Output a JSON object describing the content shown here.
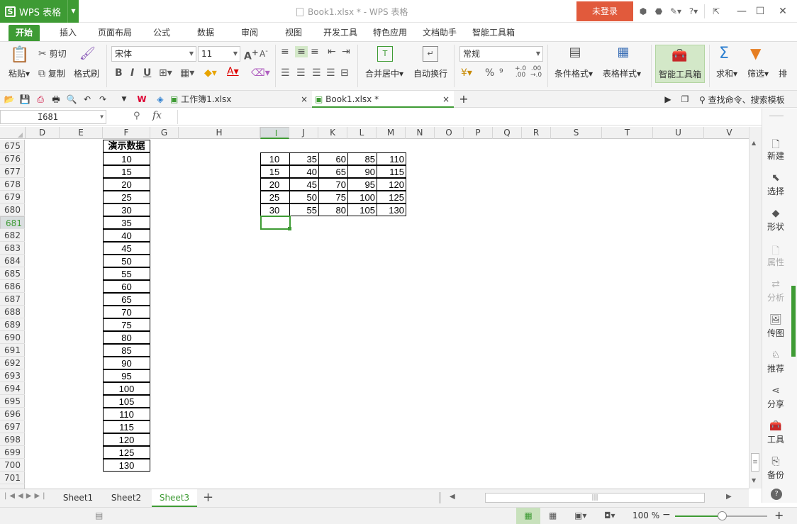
{
  "app": {
    "name": "WPS 表格",
    "window_title": "Book1.xlsx * - WPS 表格",
    "login": "未登录",
    "help": "?"
  },
  "menu": [
    "开始",
    "插入",
    "页面布局",
    "公式",
    "数据",
    "审阅",
    "视图",
    "开发工具",
    "特色应用",
    "文档助手",
    "智能工具箱"
  ],
  "ribbon": {
    "paste": "粘贴",
    "cut": "剪切",
    "copy": "复制",
    "format_painter": "格式刷",
    "font_name": "宋体",
    "font_size": "11",
    "bold": "B",
    "italic": "I",
    "underline": "U",
    "merge_center": "合并居中",
    "wrap_text": "自动换行",
    "number_format": "常规",
    "percent": "%",
    "thousands": "⁹",
    "dec_inc": "+.0\n.00",
    "dec_dec": ".00\n→.0",
    "cond_format": "条件格式",
    "table_style": "表格样式",
    "smart_toolbox": "智能工具箱",
    "sum": "求和",
    "filter": "筛选",
    "sort_partial": "排"
  },
  "doc_tabs": [
    {
      "label": "工作簿1.xlsx",
      "active": false
    },
    {
      "label": "Book1.xlsx *",
      "active": true
    }
  ],
  "search_placeholder": "查找命令、搜索模板",
  "formula_bar": {
    "name_box": "I681",
    "fx": "fx",
    "content": ""
  },
  "columns": [
    "D",
    "E",
    "F",
    "G",
    "H",
    "I",
    "J",
    "K",
    "L",
    "M",
    "N",
    "O",
    "P",
    "Q",
    "R",
    "S",
    "T",
    "U",
    "V"
  ],
  "rows": [
    "675",
    "676",
    "677",
    "678",
    "679",
    "680",
    "681",
    "682",
    "683",
    "684",
    "685",
    "686",
    "687",
    "688",
    "689",
    "690",
    "691",
    "692",
    "693",
    "694",
    "695",
    "696",
    "697",
    "698",
    "699",
    "700",
    "701"
  ],
  "selected_row": "681",
  "selected_column": "I",
  "demo_header": "演示数据",
  "demo_values": [
    "10",
    "15",
    "20",
    "25",
    "30",
    "35",
    "40",
    "45",
    "50",
    "55",
    "60",
    "65",
    "70",
    "75",
    "80",
    "85",
    "90",
    "95",
    "100",
    "105",
    "110",
    "115",
    "120",
    "125",
    "130"
  ],
  "table": [
    [
      "10",
      "35",
      "60",
      "85",
      "110"
    ],
    [
      "15",
      "40",
      "65",
      "90",
      "115"
    ],
    [
      "20",
      "45",
      "70",
      "95",
      "120"
    ],
    [
      "25",
      "50",
      "75",
      "100",
      "125"
    ],
    [
      "30",
      "55",
      "80",
      "105",
      "130"
    ]
  ],
  "right_panel": [
    {
      "label": "新建",
      "icon": "new-icon",
      "disabled": false
    },
    {
      "label": "选择",
      "icon": "select-icon",
      "disabled": false
    },
    {
      "label": "形状",
      "icon": "shape-icon",
      "disabled": false
    },
    {
      "label": "属性",
      "icon": "property-icon",
      "disabled": true
    },
    {
      "label": "分析",
      "icon": "analyze-icon",
      "disabled": true
    },
    {
      "label": "传图",
      "icon": "image-upload-icon",
      "disabled": false
    },
    {
      "label": "推荐",
      "icon": "recommend-icon",
      "disabled": false
    },
    {
      "label": "分享",
      "icon": "share-icon",
      "disabled": false
    },
    {
      "label": "工具",
      "icon": "toolbox-icon",
      "disabled": false
    },
    {
      "label": "备份",
      "icon": "backup-icon",
      "disabled": false
    }
  ],
  "sheets": [
    {
      "label": "Sheet1",
      "active": false
    },
    {
      "label": "Sheet2",
      "active": false
    },
    {
      "label": "Sheet3",
      "active": true
    }
  ],
  "zoom": "100 %",
  "colors": {
    "accent": "#3e9b34",
    "login": "#e15a3c"
  }
}
